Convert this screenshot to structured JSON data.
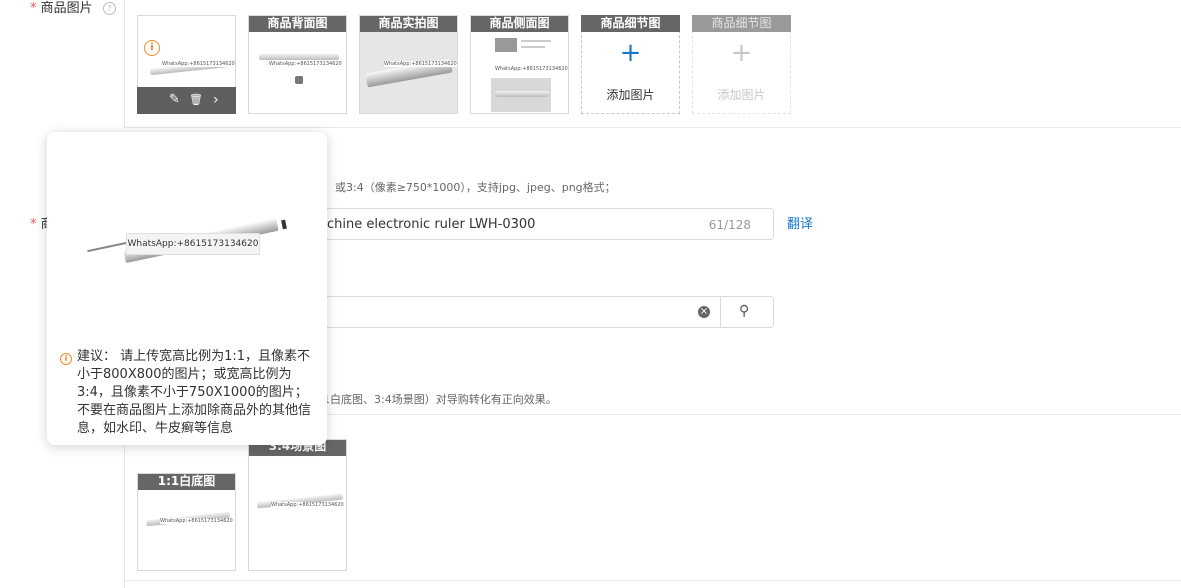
{
  "form": {
    "required_mark": "*",
    "images_label": "商品图片",
    "help_glyph": "?",
    "second_required_label": "商"
  },
  "images": {
    "back_label": "商品背面图",
    "real_label": "商品实拍图",
    "side_label": "商品侧面图",
    "detail_label": "商品细节图",
    "detail2_label": "商品细节图",
    "add_label": "添加图片",
    "add_label_disabled": "添加图片",
    "plus_glyph": "+",
    "watermark": "WhatsApp:+8615173134620",
    "tool_edit": "✎",
    "tool_delete": "🗑",
    "tool_next": "›",
    "info_glyph": "i"
  },
  "popup": {
    "watermark": "WhatsApp:+8615173134620",
    "tip": "建议： 请上传宽高比例为1:1，且像素不小于800X800的图片；或宽高比例为3:4，且像素不小于750X1000的图片；不要在商品图片上添加除商品外的其他信息，如水印、牛皮癣等信息",
    "warn_glyph": "i"
  },
  "hint_text": "或3:4（像素≥750*1000），支持jpg、jpeg、png格式；",
  "title_input": {
    "value": "achine electronic ruler LWH-0300",
    "counter": "61/128"
  },
  "translate_link": "翻译",
  "search": {
    "clear_glyph": "×",
    "search_glyph": "⚲"
  },
  "guide_text": "1白底图、3:4场景图）对导购转化有正向效果。",
  "guide": {
    "white_label": "1:1白底图",
    "scene_label": "3:4场景图"
  },
  "colors": {
    "required": "#ff4d4f",
    "link": "#1677cc",
    "warning": "#f08a24",
    "header_bg": "#666666"
  }
}
